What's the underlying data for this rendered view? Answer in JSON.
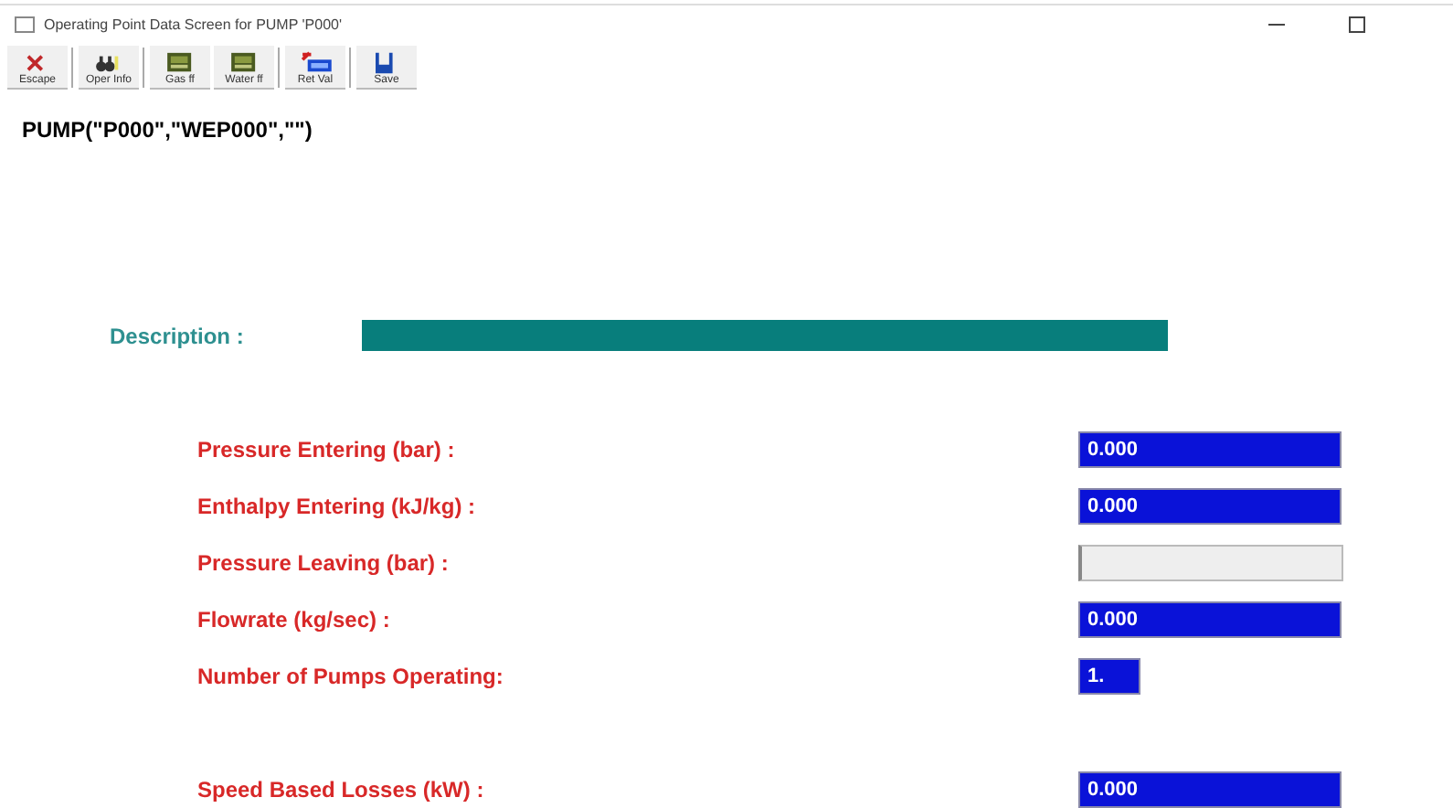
{
  "window": {
    "title": "Operating Point Data Screen for PUMP 'P000'"
  },
  "toolbar": [
    {
      "label": "Escape",
      "kind": "close"
    },
    {
      "label": "Oper Info",
      "kind": "info"
    },
    {
      "label": "Gas ff",
      "kind": "panel"
    },
    {
      "label": "Water ff",
      "kind": "panel"
    },
    {
      "label": "Ret Val",
      "kind": "retval"
    },
    {
      "label": "Save",
      "kind": "save"
    }
  ],
  "header": "PUMP(\"P000\",\"WEP000\",\"\")",
  "description": {
    "label": "Description :"
  },
  "fields": [
    {
      "label": "Pressure Entering (bar) :",
      "value": "0.000",
      "kind": "value"
    },
    {
      "label": "Enthalpy Entering (kJ/kg) :",
      "value": "0.000",
      "kind": "value"
    },
    {
      "label": "Pressure Leaving (bar) :",
      "kind": "empty"
    },
    {
      "label": "Flowrate (kg/sec) :",
      "value": "0.000",
      "kind": "value"
    },
    {
      "label": "Number of Pumps Operating:",
      "value": "1.",
      "kind": "count"
    },
    {
      "label": "Speed Based Losses (kW) :",
      "value": "0.000",
      "kind": "value",
      "gap": true
    }
  ]
}
